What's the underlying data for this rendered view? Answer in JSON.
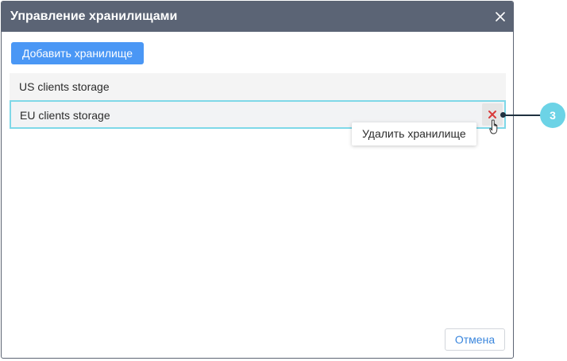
{
  "dialog": {
    "title": "Управление хранилищами",
    "add_button_label": "Добавить хранилище",
    "cancel_button_label": "Отмена"
  },
  "storages": [
    {
      "label": "US clients storage"
    },
    {
      "label": "EU clients storage"
    }
  ],
  "tooltip": {
    "text": "Удалить хранилище"
  },
  "callout": {
    "number": "3"
  },
  "colors": {
    "header_bg": "#5b6475",
    "primary_button": "#4a97f5",
    "selected_border": "#7fd8e8",
    "delete_icon": "#d93a3a",
    "callout_badge": "#6cd3e6"
  },
  "icons": {
    "close": "close-icon",
    "delete": "delete-x-icon",
    "cursor": "hand-pointer-icon"
  }
}
